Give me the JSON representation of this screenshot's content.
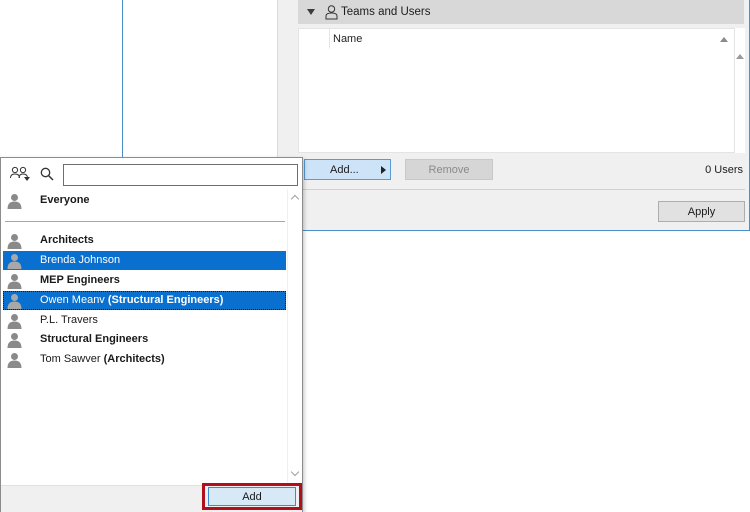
{
  "dialog": {
    "section_title": "Teams and Users",
    "column_name": "Name",
    "add_label": "Add...",
    "remove_label": "Remove",
    "user_count": "0 Users",
    "apply_label": "Apply"
  },
  "popup": {
    "search_placeholder": "",
    "add_label": "Add",
    "items": [
      {
        "label": "Everyone",
        "team": "",
        "style": "team"
      },
      {
        "label": "Architects",
        "team": "",
        "style": "team"
      },
      {
        "label": "Brenda Johnson",
        "team": "",
        "style": "user",
        "selected": true
      },
      {
        "label": "MEP Engineers",
        "team": "",
        "style": "team"
      },
      {
        "label": "Owen Meanv",
        "team": "(Structural Engineers)",
        "style": "user",
        "selected": true
      },
      {
        "label": "P.L. Travers",
        "team": "",
        "style": "user"
      },
      {
        "label": "Structural Engineers",
        "team": "",
        "style": "team"
      },
      {
        "label": "Tom Sawver",
        "team": "(Architects)",
        "style": "user"
      }
    ]
  },
  "colors": {
    "selection": "#0a70d0",
    "highlight_border": "#b0101e",
    "dialog_border": "#4a90c8"
  },
  "icons": [
    "team-user-icon",
    "search-icon",
    "person-icon",
    "sort-arrow-icon",
    "submenu-arrow-icon"
  ]
}
